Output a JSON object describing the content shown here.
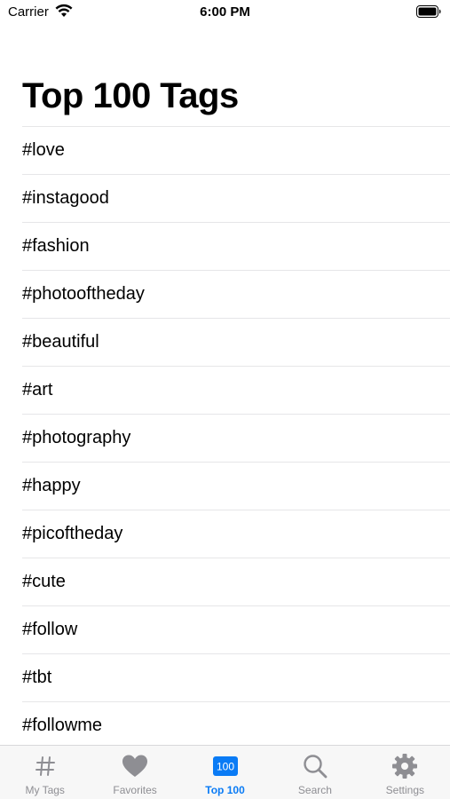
{
  "status_bar": {
    "carrier": "Carrier",
    "time": "6:00 PM"
  },
  "page": {
    "title": "Top 100 Tags"
  },
  "tags": [
    "#love",
    "#instagood",
    "#fashion",
    "#photooftheday",
    "#beautiful",
    "#art",
    "#photography",
    "#happy",
    "#picoftheday",
    "#cute",
    "#follow",
    "#tbt",
    "#followme"
  ],
  "tab_bar": {
    "active_color": "#0a7bf5",
    "inactive_color": "#8e8e93",
    "tabs": [
      {
        "label": "My Tags",
        "icon": "hashtag-icon",
        "active": false
      },
      {
        "label": "Favorites",
        "icon": "heart-icon",
        "active": false
      },
      {
        "label": "Top 100",
        "icon": "top-100-badge-icon",
        "badge": "100",
        "active": true
      },
      {
        "label": "Search",
        "icon": "magnifying-glass-icon",
        "active": false
      },
      {
        "label": "Settings",
        "icon": "gear-icon",
        "active": false
      }
    ]
  }
}
